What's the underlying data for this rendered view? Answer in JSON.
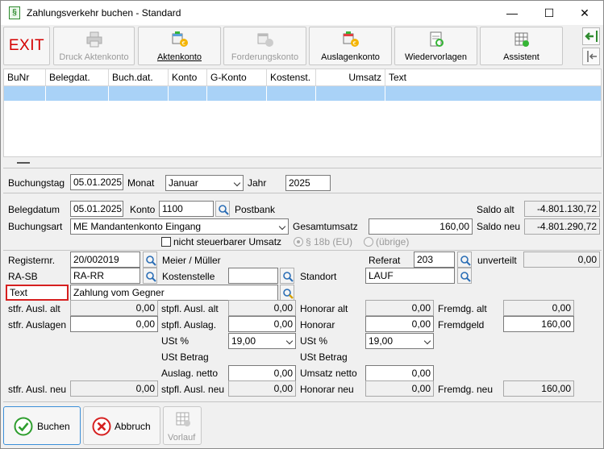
{
  "window": {
    "title": "Zahlungsverkehr buchen - Standard",
    "app_icon_glyph": "§"
  },
  "window_controls": {
    "minimize": "—",
    "maximize": "☐",
    "close": "✕"
  },
  "toolbar": {
    "exit": "EXIT",
    "druck": "Druck Aktenkonto",
    "aktenkonto": "Aktenkonto",
    "forderungskonto": "Forderungskonto",
    "auslagenkonto": "Auslagenkonto",
    "wiedervorlagen": "Wiedervorlagen",
    "assistent": "Assistent"
  },
  "grid": {
    "columns": [
      "BuNr",
      "Belegdat.",
      "Buch.dat.",
      "Konto",
      "G-Konto",
      "Kostenst.",
      "Umsatz",
      "Text"
    ]
  },
  "header_fields": {
    "buchungstag_label": "Buchungstag",
    "buchungstag": "05.01.2025",
    "monat_label": "Monat",
    "monat": "Januar",
    "jahr_label": "Jahr",
    "jahr": "2025"
  },
  "beleg": {
    "belegdatum_label": "Belegdatum",
    "belegdatum": "05.01.2025",
    "konto_label": "Konto",
    "konto": "1100",
    "konto_name": "Postbank",
    "saldo_alt_label": "Saldo alt",
    "saldo_alt": "-4.801.130,72",
    "saldo_neu_label": "Saldo neu",
    "saldo_neu": "-4.801.290,72",
    "buchungsart_label": "Buchungsart",
    "buchungsart": "ME Mandantenkonto Eingang",
    "gesamtumsatz_label": "Gesamtumsatz",
    "gesamtumsatz": "160,00",
    "nicht_steuerbar": "nicht steuerbarer Umsatz",
    "radio_18b": "§ 18b (EU)",
    "radio_uebrige": "(übrige)"
  },
  "akte": {
    "registernr_label": "Registernr.",
    "registernr": "20/002019",
    "mandant": "Meier / Müller",
    "referat_label": "Referat",
    "referat": "203",
    "unverteilt_label": "unverteilt",
    "unverteilt": "0,00",
    "rasb_label": "RA-SB",
    "rasb": "RA-RR",
    "kostenstelle_label": "Kostenstelle",
    "kostenstelle": "",
    "standort_label": "Standort",
    "standort": "LAUF",
    "text_label": "Text",
    "text": "Zahlung vom Gegner"
  },
  "betraege": {
    "stfr_ausl_alt_label": "stfr. Ausl. alt",
    "stfr_ausl_alt": "0,00",
    "stpfl_ausl_alt_label": "stpfl. Ausl. alt",
    "stpfl_ausl_alt": "0,00",
    "honorar_alt_label": "Honorar alt",
    "honorar_alt": "0,00",
    "fremdg_alt_label": "Fremdg. alt",
    "fremdg_alt": "0,00",
    "stfr_auslagen_label": "stfr. Auslagen",
    "stfr_auslagen": "0,00",
    "stpfl_auslag_label": "stpfl. Auslag.",
    "stpfl_auslag": "0,00",
    "honorar_label": "Honorar",
    "honorar": "0,00",
    "fremdgeld_label": "Fremdgeld",
    "fremdgeld": "160,00",
    "ust1_label": "USt %",
    "ust1": "19,00",
    "ust2_label": "USt %",
    "ust2": "19,00",
    "ust_betrag1_label": "USt Betrag",
    "ust_betrag2_label": "USt Betrag",
    "auslag_netto_label": "Auslag. netto",
    "auslag_netto": "0,00",
    "umsatz_netto_label": "Umsatz netto",
    "umsatz_netto": "0,00",
    "stfr_ausl_neu_label": "stfr. Ausl. neu",
    "stfr_ausl_neu": "0,00",
    "stpfl_ausl_neu_label": "stpfl. Ausl. neu",
    "stpfl_ausl_neu": "0,00",
    "honorar_neu_label": "Honorar neu",
    "honorar_neu": "0,00",
    "fremdg_neu_label": "Fremdg. neu",
    "fremdg_neu": "160,00"
  },
  "buttons": {
    "buchen": "Buchen",
    "abbruch": "Abbruch",
    "vorlauf": "Vorlauf"
  },
  "colors": {
    "accent_green": "#2e9e2e",
    "danger_red": "#d62020",
    "selection": "#a9d2f7"
  }
}
